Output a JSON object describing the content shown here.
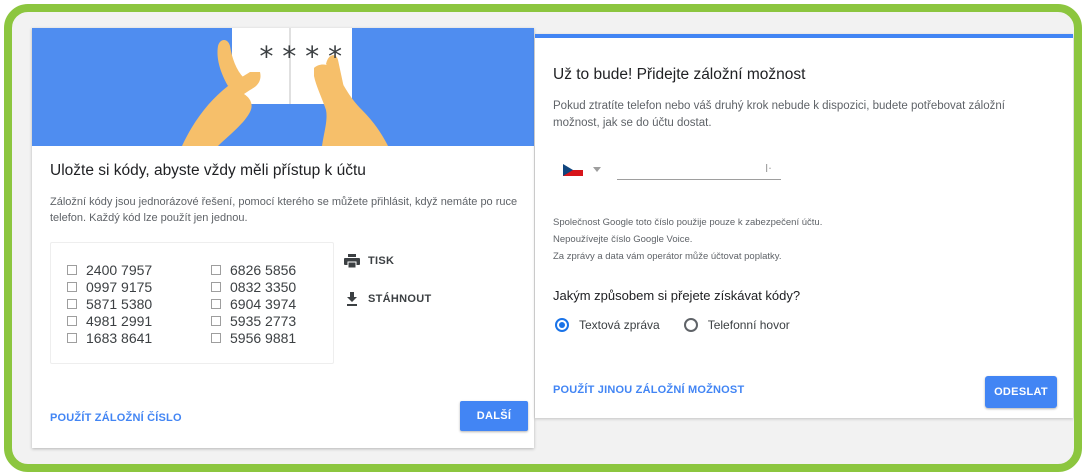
{
  "colors": {
    "frame_border": "#8cc63f",
    "accent_blue": "#4285f4",
    "hero_blue": "#4f8df0",
    "skin": "#f6bf6a"
  },
  "left": {
    "hero_code": "****",
    "title": "Uložte si kódy, abyste vždy měli přístup k účtu",
    "description": "Záložní kódy jsou jednorázové řešení, pomocí kterého se můžete přihlásit, když nemáte po ruce telefon. Každý kód lze použít jen jednou.",
    "codes_col1": [
      "2400 7957",
      "0997 9175",
      "5871 5380",
      "4981 2991",
      "1683 8641"
    ],
    "codes_col2": [
      "6826 5856",
      "0832 3350",
      "6904 3974",
      "5935 2773",
      "5956 9881"
    ],
    "print_label": "TISK",
    "print_icon": "printer-icon",
    "download_label": "STÁHNOUT",
    "download_icon": "download-icon",
    "link": "POUŽÍT ZÁLOŽNÍ ČÍSLO",
    "next_button": "DALŠÍ"
  },
  "right": {
    "title": "Už to bude! Přidejte záložní možnost",
    "description": "Pokud ztratíte telefon nebo váš druhý krok nebude k dispozici, budete potřebovat záložní možnost, jak se do účtu dostat.",
    "country_flag": "czech-flag-icon",
    "phone_value": "",
    "notes": [
      "Společnost Google toto číslo použije pouze k zabezpečení účtu.",
      "Nepoužívejte číslo Google Voice.",
      "Za zprávy a data vám operátor může účtovat poplatky."
    ],
    "question": "Jakým způsobem si přejete získávat kódy?",
    "option_sms": "Textová zpráva",
    "option_call": "Telefonní hovor",
    "selected_option": "Textová zpráva",
    "link": "POUŽÍT JINOU ZÁLOŽNÍ MOŽNOST",
    "send_button": "ODESLAT"
  }
}
